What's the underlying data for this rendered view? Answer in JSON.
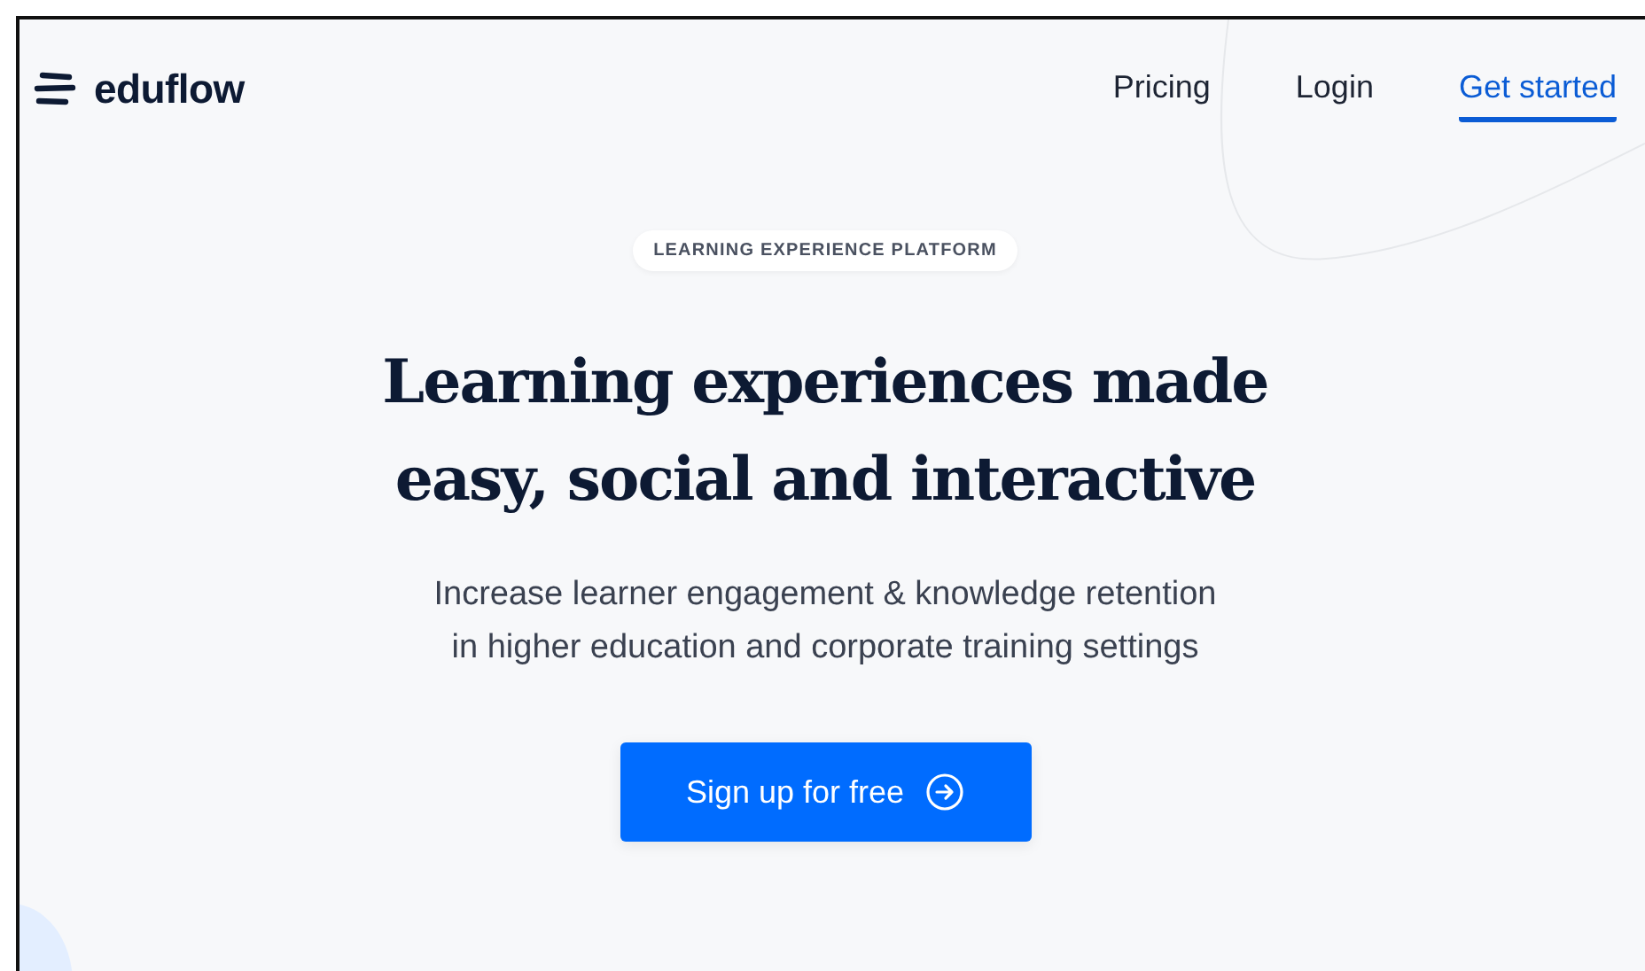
{
  "logo": {
    "text": "eduflow"
  },
  "nav": [
    {
      "label": "Pricing",
      "selected": false
    },
    {
      "label": "Login",
      "selected": false
    },
    {
      "label": "Get started",
      "selected": true
    }
  ],
  "hero": {
    "badge": "LEARNING EXPERIENCE PLATFORM",
    "title_lines": [
      "Learning experiences made",
      "easy, social and interactive"
    ],
    "subtitle_lines": [
      "Increase learner engagement & knowledge retention",
      "in higher education and corporate training settings"
    ],
    "cta": "Sign up for free"
  }
}
